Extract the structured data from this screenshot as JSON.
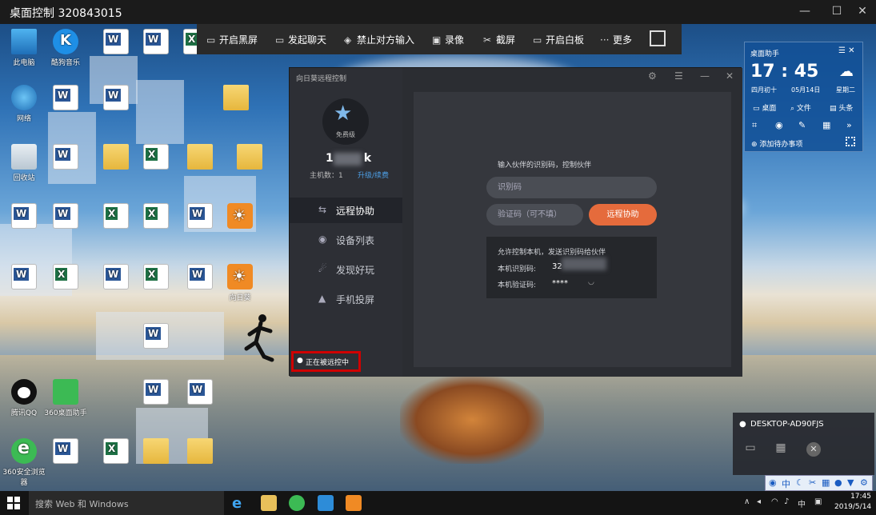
{
  "window": {
    "title": "桌面控制 320843015",
    "minimize_icon": "minimize-icon",
    "maximize_icon": "maximize-icon",
    "close_icon": "close-icon"
  },
  "toolbar": {
    "items": [
      {
        "label": "开启黑屏",
        "icon": "monitor-icon"
      },
      {
        "label": "发起聊天",
        "icon": "chat-icon"
      },
      {
        "label": "禁止对方输入",
        "icon": "block-input-icon"
      },
      {
        "label": "录像",
        "icon": "record-icon"
      },
      {
        "label": "截屏",
        "icon": "scissors-icon"
      },
      {
        "label": "开启白板",
        "icon": "whiteboard-icon"
      },
      {
        "label": "更多",
        "icon": "more-icon"
      }
    ],
    "fullscreen_icon": "fullscreen-icon"
  },
  "desktop_icons": [
    {
      "label": "此电脑"
    },
    {
      "label": "酷狗音乐"
    },
    {
      "label": "网络"
    },
    {
      "label": "回收站"
    },
    {
      "label": "向日葵"
    },
    {
      "label": "腾讯QQ"
    },
    {
      "label": "360桌面助手"
    },
    {
      "label": "360安全浏览器"
    }
  ],
  "widget": {
    "title": "桌面助手",
    "time": "17 : 45",
    "lunar": "四月初十",
    "date": "05月14日",
    "weekday": "星期二",
    "links": [
      "桌面",
      "文件",
      "头条"
    ],
    "todo": "添加待办事项"
  },
  "sunlogin": {
    "title": "向日葵远程控制",
    "level": "免费级",
    "username_visible": "1",
    "username_suffix": "k",
    "host_count": "主机数：1",
    "upgrade": "升级/续费",
    "nav": [
      {
        "label": "远程协助",
        "icon": "remote-assist-icon",
        "active": true
      },
      {
        "label": "设备列表",
        "icon": "device-list-icon",
        "active": false
      },
      {
        "label": "发现好玩",
        "icon": "discover-icon",
        "active": false
      },
      {
        "label": "手机投屏",
        "icon": "phone-cast-icon",
        "active": false
      }
    ],
    "status": "正在被远控中",
    "panel": {
      "heading": "输入伙伴的识别码，控制伙伴",
      "id_placeholder": "识别码",
      "code_placeholder": "验证码（可不填）",
      "assist_button": "远程协助",
      "allow_title": "允许控制本机，发送识别码给伙伴",
      "local_id_label": "本机识别码:",
      "local_id_value": "32",
      "local_code_label": "本机验证码:",
      "local_code_value": "****"
    }
  },
  "session": {
    "device": "DESKTOP-AD90FJS"
  },
  "taskbar": {
    "search_placeholder": "搜索 Web 和 Windows",
    "ime_lang": "中",
    "clock_time": "17:45",
    "clock_date": "2019/5/14"
  },
  "ime_bar": {
    "lang": "中"
  }
}
